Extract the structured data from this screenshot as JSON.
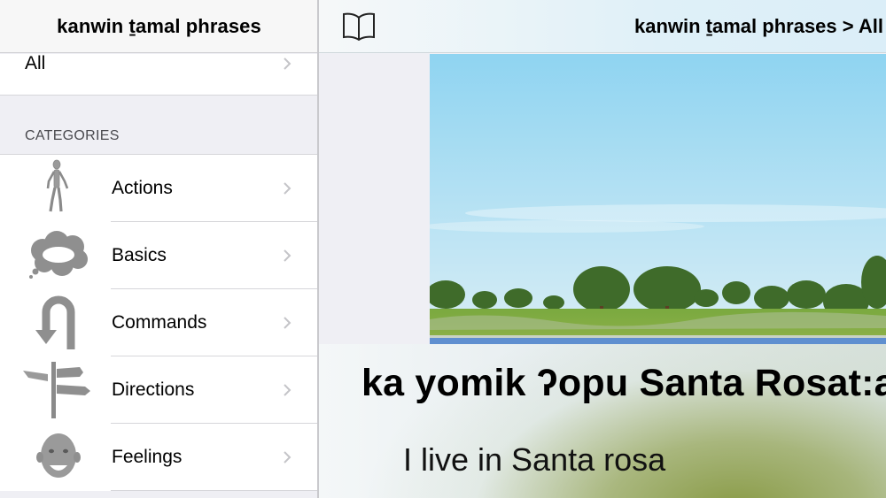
{
  "sidebar": {
    "title": "kanwin ṯamal phrases",
    "all_label": "All",
    "section_label": "CATEGORIES",
    "categories": [
      {
        "label": "Actions",
        "icon": "figure-icon"
      },
      {
        "label": "Basics",
        "icon": "thought-bubble-icon"
      },
      {
        "label": "Commands",
        "icon": "u-turn-arrow-icon"
      },
      {
        "label": "Directions",
        "icon": "signpost-icon"
      },
      {
        "label": "Feelings",
        "icon": "face-icon"
      }
    ]
  },
  "main": {
    "breadcrumb": "kanwin ṯamal phrases > All",
    "book_icon": "book-icon",
    "phrase_native": "ka yomik ʔopu Santa Rosat:a",
    "phrase_english": "I live in Santa rosa"
  },
  "colors": {
    "sky": "#a8dcf2",
    "grass": "#7ea63f",
    "separator": "#d6d6da",
    "sidebar_bg": "#efeff4"
  }
}
